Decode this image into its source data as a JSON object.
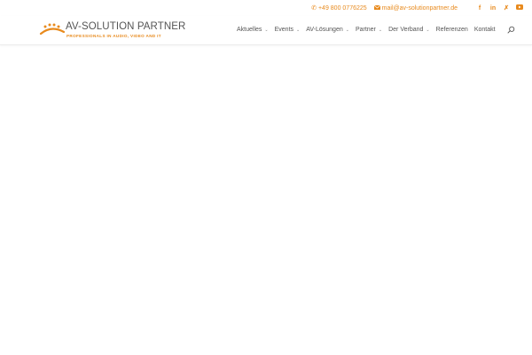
{
  "topbar": {
    "phone": "+49 800 0776225",
    "email": "mail@av-solutionpartner.de",
    "social_icons": [
      "facebook-icon",
      "linkedin-icon",
      "xing-icon",
      "youtube-icon"
    ]
  },
  "brand": {
    "name": "AV-SOLUTION PARTNER",
    "tagline": "PROFESSIONALS IN AUDIO, VIDEO AND IT",
    "accent_color": "#e88a1d",
    "text_color": "#555555"
  },
  "nav": {
    "items": [
      {
        "label": "Aktuelles",
        "has_dropdown": true
      },
      {
        "label": "Events",
        "has_dropdown": true
      },
      {
        "label": "AV-Lösungen",
        "has_dropdown": true
      },
      {
        "label": "Partner",
        "has_dropdown": true
      },
      {
        "label": "Der Verband",
        "has_dropdown": true
      },
      {
        "label": "Referenzen",
        "has_dropdown": false
      },
      {
        "label": "Kontakt",
        "has_dropdown": false
      }
    ],
    "search_icon": "search-icon"
  }
}
